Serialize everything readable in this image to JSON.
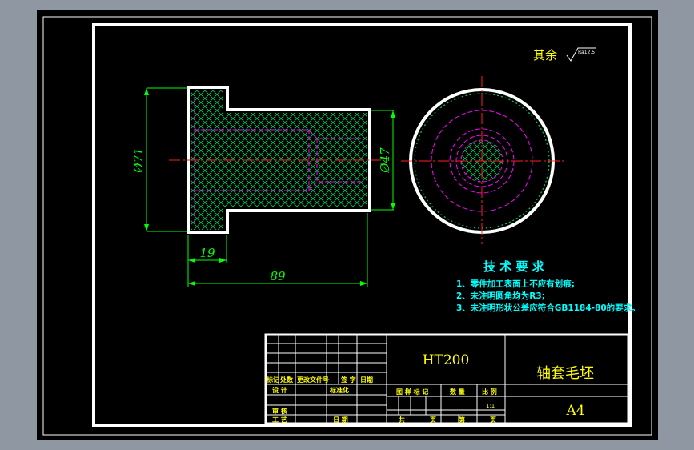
{
  "surface_note": {
    "roughness_prefix": "其余",
    "roughness_value": "Ra12.5"
  },
  "dimensions": {
    "outer_diameter": "Ø71",
    "inner_diameter": "Ø47",
    "flange_width": "19",
    "total_length": "89"
  },
  "tech_requirements": {
    "title": "技 术 要 求",
    "items": [
      "1、零件加工表面上不应有划痕;",
      "2、未注明圆角均为R3;",
      "3、未注明形状公差应符合GB1184-80的要求。"
    ]
  },
  "title_block": {
    "material": "HT200",
    "part_name": "轴套毛坯",
    "sheet_size": "A4",
    "labels": {
      "mark": "标记",
      "count": "处数",
      "change_doc": "更改文件号",
      "sign": "签 字",
      "date": "日期",
      "design": "设 计",
      "standardize": "标准化",
      "review": "审 核",
      "process": "工 艺",
      "date2": "日 期",
      "stage_mark": "图 样 标 记",
      "quantity": "数 量",
      "ratio": "比 例",
      "total": "共",
      "sheet": "页",
      "number": "第",
      "page": "页"
    },
    "scale": "1:1"
  },
  "colors": {
    "viewport_bg": "#000000",
    "frame": "#ffffff",
    "dimension": "#00ff00",
    "centerline": "#ff2020",
    "hidden_line": "#ff00ff",
    "hatch": "#00ff66",
    "note_text": "#00ffff",
    "title_text": "#ffff00"
  }
}
